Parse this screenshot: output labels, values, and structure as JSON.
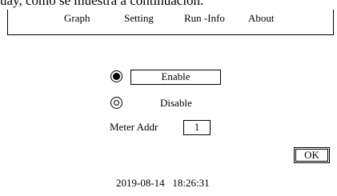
{
  "caption": {
    "text": "uay, como se muestra a continuación."
  },
  "menu": {
    "items": [
      {
        "label": "Graph"
      },
      {
        "label": "Setting"
      },
      {
        "label": "Run -Info"
      },
      {
        "label": "About"
      }
    ]
  },
  "comm": {
    "enable_label": "Enable",
    "disable_label": "Disable",
    "selected": "Enable",
    "meter_addr_label": "Meter Addr",
    "meter_addr_value": "1"
  },
  "actions": {
    "ok_label": "OK"
  },
  "status": {
    "datetime": "2019-08-14   18:26:31"
  }
}
